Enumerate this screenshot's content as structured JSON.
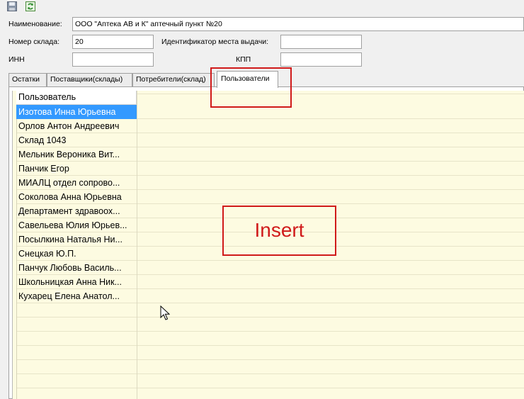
{
  "toolbar": {
    "save_icon": "save-icon",
    "refresh_icon": "refresh-icon"
  },
  "form": {
    "name_label": "Наименование:",
    "name_value": "ООО \"Аптека АВ и К\" аптечный пункт №20",
    "warehouse_label": "Номер склада:",
    "warehouse_value": "20",
    "issue_point_label": "Идентификатор места выдачи:",
    "issue_point_value": "",
    "inn_label": "ИНН",
    "inn_value": "",
    "kpp_label": "КПП",
    "kpp_value": ""
  },
  "tabs": [
    {
      "label": "Остатки"
    },
    {
      "label": "Поставщики(склады)"
    },
    {
      "label": "Потребители(склад)"
    },
    {
      "label": "Пользователи",
      "active": true
    }
  ],
  "grid": {
    "column_header": "Пользователь",
    "rows": [
      "Изотова Инна Юрьевна",
      "Орлов Антон Андреевич",
      "Склад 1043",
      "Мельник Вероника Вит...",
      "Панчик Егор",
      "МИАЛЦ отдел сопрово...",
      "Соколова Анна Юрьевна",
      "Департамент здравоох...",
      "Савельева Юлия Юрьев...",
      "Посылкина Наталья Ни...",
      "Снецкая Ю.П.",
      "Панчук Любовь Василь...",
      "Школьницкая Анна Ник...",
      "Кухарец Елена Анатол..."
    ],
    "selected_index": 0
  },
  "annotation": {
    "insert_label": "Insert",
    "color": "#d01a1a"
  },
  "colors": {
    "grid_background": "#fdfbe1",
    "selection": "#3399ff"
  }
}
